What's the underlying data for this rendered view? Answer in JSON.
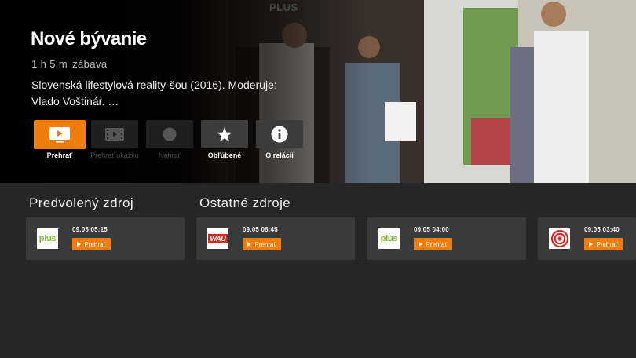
{
  "hero": {
    "channel_watermark": "PLUS",
    "title": "Nové bývanie",
    "duration": "1 h 5 m",
    "genre": "zábava",
    "description": "Slovenská lifestylová reality-šou (2016). Moderuje: Vlado Voštinár. …"
  },
  "actions": [
    {
      "label": "Prehrať",
      "icon": "tv-play-icon",
      "state": "focused"
    },
    {
      "label": "Prehrať ukážku",
      "icon": "film-icon",
      "state": "disabled"
    },
    {
      "label": "Nahrať",
      "icon": "record-icon",
      "state": "disabled"
    },
    {
      "label": "Obľúbené",
      "icon": "star-icon",
      "state": "enabled"
    },
    {
      "label": "O relácii",
      "icon": "info-icon",
      "state": "enabled"
    }
  ],
  "sources": {
    "default_title": "Predvolený zdroj",
    "other_title": "Ostatné zdroje",
    "play_label": "Prehrať",
    "cards": [
      {
        "channel_logo": "plus",
        "time": "09.05 05:15"
      },
      {
        "channel_logo": "WAU",
        "time": "09.05 06:45"
      },
      {
        "channel_logo": "plus",
        "time": "09.05 04:00"
      },
      {
        "channel_logo": "joj-logo",
        "time": "09.05 03:40"
      }
    ]
  },
  "colors": {
    "accent": "#f07c0c",
    "background": "#262626",
    "card": "#3a3a3a"
  }
}
